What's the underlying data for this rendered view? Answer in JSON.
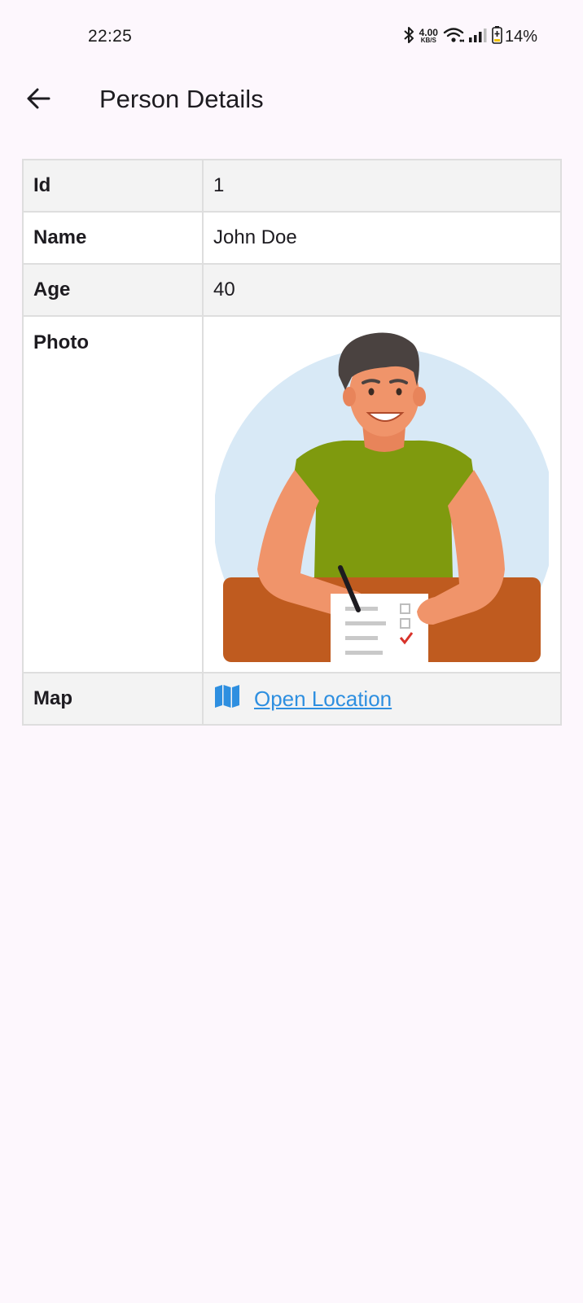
{
  "status_bar": {
    "time": "22:25",
    "network_speed_value": "4.00",
    "network_speed_unit": "KB/S",
    "battery_percent": "14%",
    "icons": [
      "bluetooth-icon",
      "wifi-icon",
      "signal-icon",
      "battery-icon"
    ]
  },
  "app_bar": {
    "back_icon": "arrow-back-icon",
    "title": "Person Details"
  },
  "details": {
    "rows": [
      {
        "label": "Id",
        "value": "1"
      },
      {
        "label": "Name",
        "value": "John Doe"
      },
      {
        "label": "Age",
        "value": "40"
      },
      {
        "label": "Photo"
      },
      {
        "label": "Map",
        "link_text": "Open Location",
        "link_icon": "map-icon"
      }
    ]
  },
  "colors": {
    "background": "#fdf7fd",
    "link": "#2e8fe0",
    "shaded_row": "#f3f3f3",
    "border": "#dedede"
  }
}
